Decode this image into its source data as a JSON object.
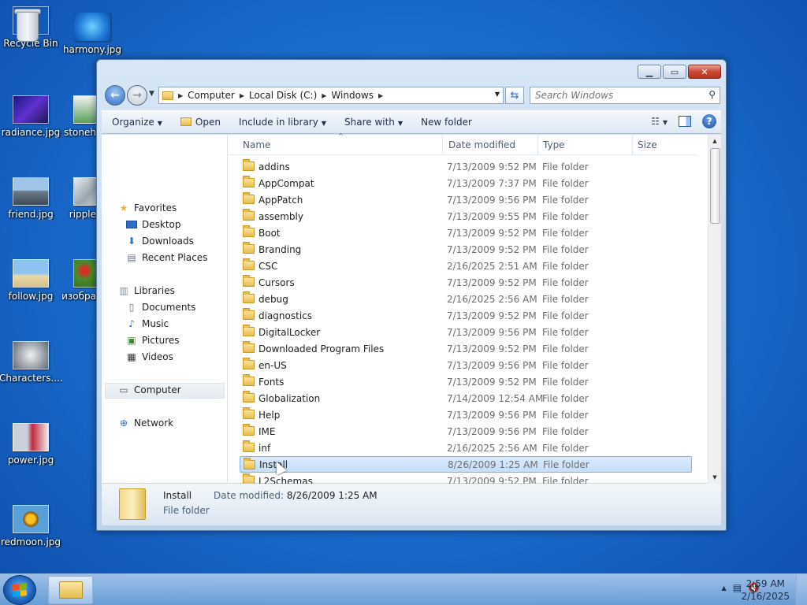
{
  "desktop": {
    "icons": [
      {
        "label": "Recycle Bin",
        "icon": "recycle-bin-icon"
      },
      {
        "label": "harmony.jpg",
        "icon": "image-thumbnail"
      },
      {
        "label": "radiance.jpg",
        "icon": "image-thumbnail"
      },
      {
        "label": "stoneh",
        "icon": "image-thumbnail"
      },
      {
        "label": "friend.jpg",
        "icon": "image-thumbnail"
      },
      {
        "label": "ripple",
        "icon": "image-thumbnail"
      },
      {
        "label": "follow.jpg",
        "icon": "image-thumbnail"
      },
      {
        "label": "изобра",
        "icon": "image-thumbnail"
      },
      {
        "label": "Characters....",
        "icon": "image-thumbnail"
      },
      {
        "label": "power.jpg",
        "icon": "image-thumbnail"
      },
      {
        "label": "redmoon.jpg",
        "icon": "image-thumbnail"
      }
    ]
  },
  "window": {
    "caption": {
      "minimize": "▁",
      "maximize": "▭",
      "close": "✕"
    },
    "address": {
      "crumbs": [
        "Computer",
        "Local Disk (C:)",
        "Windows"
      ],
      "search_placeholder": "Search Windows"
    },
    "toolbar": {
      "organize": "Organize",
      "open": "Open",
      "include_in_library": "Include in library",
      "share_with": "Share with",
      "new_folder": "New folder"
    },
    "nav_pane": {
      "favorites": "Favorites",
      "desktop": "Desktop",
      "downloads": "Downloads",
      "recent_places": "Recent Places",
      "libraries": "Libraries",
      "documents": "Documents",
      "music": "Music",
      "pictures": "Pictures",
      "videos": "Videos",
      "computer": "Computer",
      "network": "Network"
    },
    "columns": {
      "name": "Name",
      "date": "Date modified",
      "type": "Type",
      "size": "Size"
    },
    "files": [
      {
        "name": "addins",
        "date": "7/13/2009 9:52 PM",
        "type": "File folder"
      },
      {
        "name": "AppCompat",
        "date": "7/13/2009 7:37 PM",
        "type": "File folder"
      },
      {
        "name": "AppPatch",
        "date": "7/13/2009 9:56 PM",
        "type": "File folder"
      },
      {
        "name": "assembly",
        "date": "7/13/2009 9:55 PM",
        "type": "File folder"
      },
      {
        "name": "Boot",
        "date": "7/13/2009 9:52 PM",
        "type": "File folder"
      },
      {
        "name": "Branding",
        "date": "7/13/2009 9:52 PM",
        "type": "File folder"
      },
      {
        "name": "CSC",
        "date": "2/16/2025 2:51 AM",
        "type": "File folder"
      },
      {
        "name": "Cursors",
        "date": "7/13/2009 9:52 PM",
        "type": "File folder"
      },
      {
        "name": "debug",
        "date": "2/16/2025 2:56 AM",
        "type": "File folder"
      },
      {
        "name": "diagnostics",
        "date": "7/13/2009 9:52 PM",
        "type": "File folder"
      },
      {
        "name": "DigitalLocker",
        "date": "7/13/2009 9:56 PM",
        "type": "File folder"
      },
      {
        "name": "Downloaded Program Files",
        "date": "7/13/2009 9:52 PM",
        "type": "File folder"
      },
      {
        "name": "en-US",
        "date": "7/13/2009 9:56 PM",
        "type": "File folder"
      },
      {
        "name": "Fonts",
        "date": "7/13/2009 9:52 PM",
        "type": "File folder"
      },
      {
        "name": "Globalization",
        "date": "7/14/2009 12:54 AM",
        "type": "File folder"
      },
      {
        "name": "Help",
        "date": "7/13/2009 9:56 PM",
        "type": "File folder"
      },
      {
        "name": "IME",
        "date": "7/13/2009 9:56 PM",
        "type": "File folder"
      },
      {
        "name": "inf",
        "date": "2/16/2025 2:56 AM",
        "type": "File folder"
      },
      {
        "name": "Install",
        "date": "8/26/2009 1:25 AM",
        "type": "File folder",
        "selected": true
      },
      {
        "name": "L2Schemas",
        "date": "7/13/2009 9:52 PM",
        "type": "File folder"
      }
    ],
    "details": {
      "name": "Install",
      "date_label": "Date modified:",
      "date_value": "8/26/2009 1:25 AM",
      "type": "File folder"
    }
  },
  "taskbar": {
    "time": "2:59 AM",
    "date": "2/16/2025",
    "tray_expand": "▲"
  },
  "colors": {
    "desktop_bg": "#1b6fcf",
    "selection": "#cce4f7",
    "taskbar": "#8fb8e3"
  }
}
